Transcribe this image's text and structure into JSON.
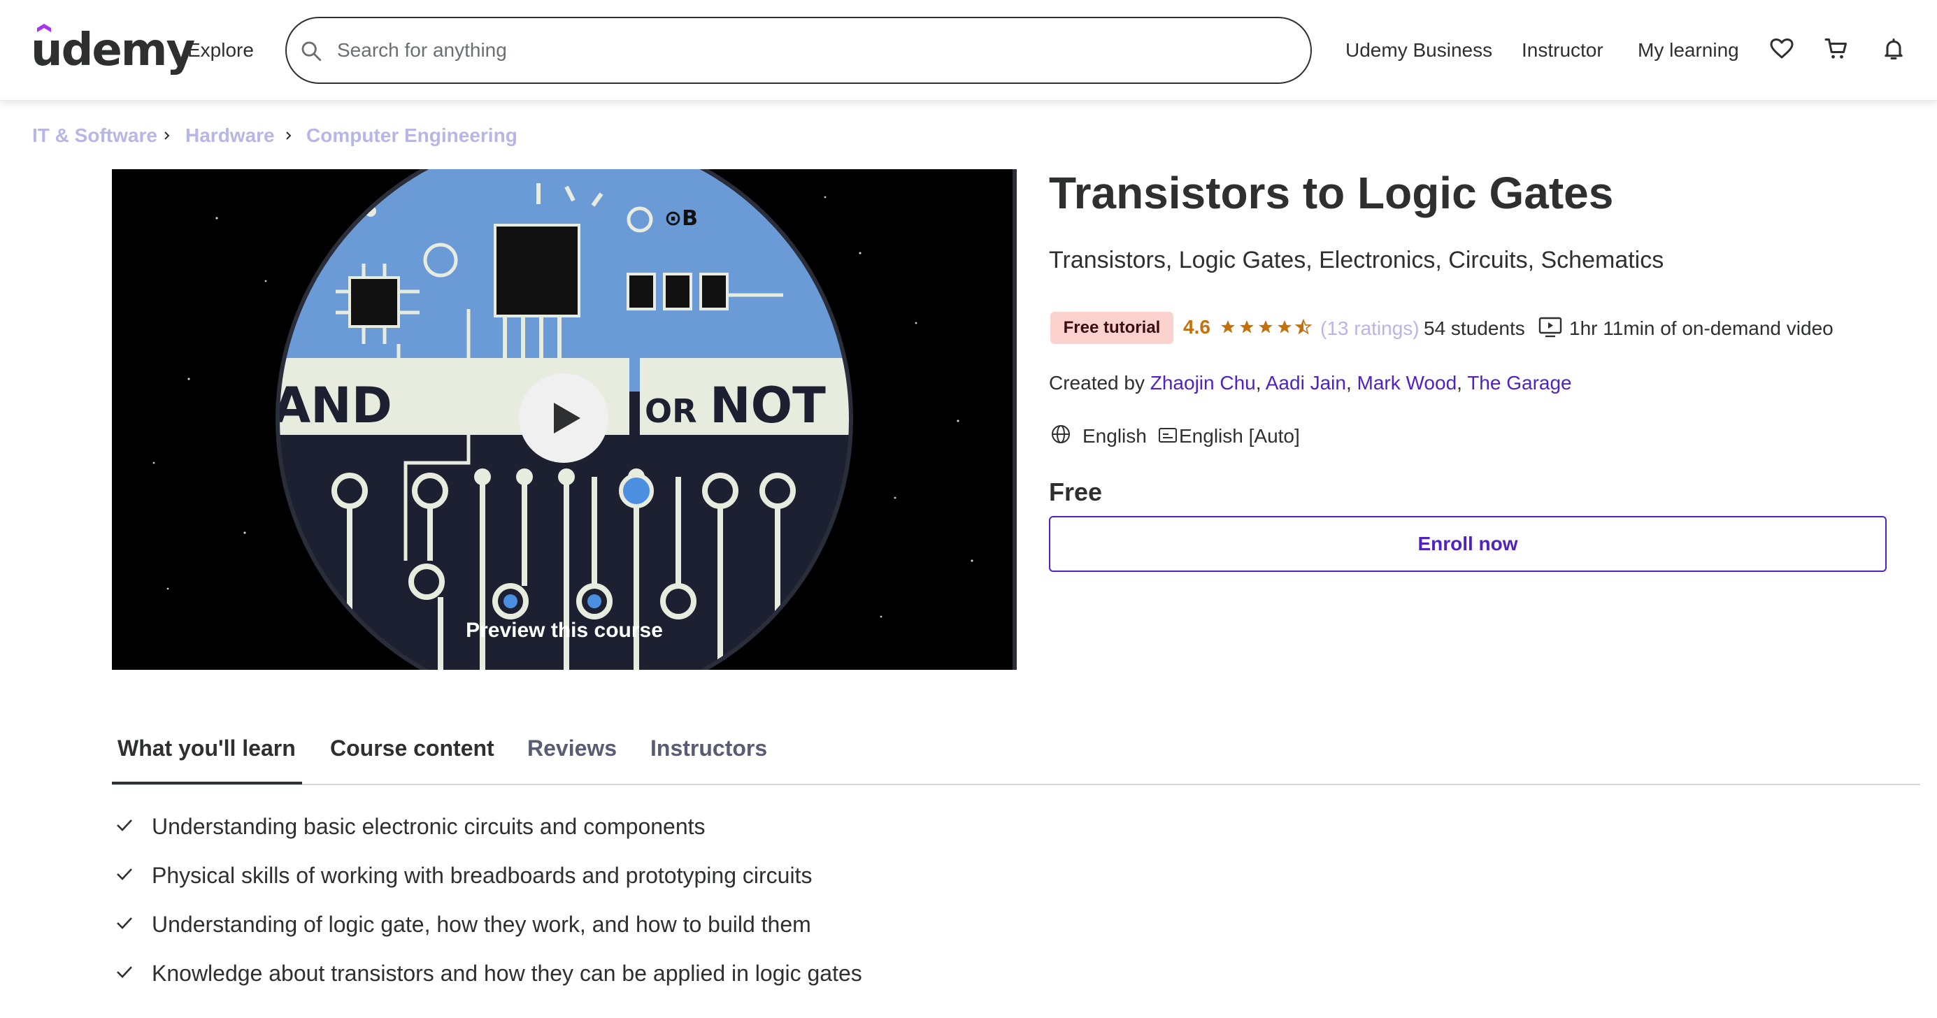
{
  "header": {
    "logo_text": "udemy",
    "explore_label": "Explore",
    "search_placeholder": "Search for anything",
    "nav": {
      "business": "Udemy Business",
      "instructor": "Instructor",
      "my_learning": "My learning"
    },
    "icons": [
      "heart-icon",
      "cart-icon",
      "bell-icon"
    ]
  },
  "breadcrumb": [
    "IT & Software",
    "Hardware",
    "Computer Engineering"
  ],
  "preview": {
    "label": "Preview this course",
    "image_text": {
      "and": "AND",
      "or": "OR",
      "not": "NOT",
      "corner": "⊙B"
    }
  },
  "course": {
    "title": "Transistors to Logic Gates",
    "subtitle": "Transistors, Logic Gates, Electronics, Circuits, Schematics",
    "badge": "Free tutorial",
    "rating": "4.6",
    "rating_value": 4.6,
    "rating_count": "(13 ratings)",
    "students": "54 students",
    "video_length": "1hr 11min of on-demand video",
    "created_by_label": "Created by",
    "authors": [
      "Zhaojin Chu",
      "Aadi Jain",
      "Mark Wood",
      "The Garage"
    ],
    "language": "English",
    "captions": "English [Auto]",
    "price": "Free",
    "enroll_label": "Enroll now"
  },
  "tabs": [
    {
      "label": "What you'll learn",
      "active": true
    },
    {
      "label": "Course content",
      "active": false
    },
    {
      "label": "Reviews",
      "active": false
    },
    {
      "label": "Instructors",
      "active": false
    }
  ],
  "learn_items": [
    "Understanding basic electronic circuits and components",
    "Physical skills of working with breadboards and prototyping circuits",
    "Understanding of logic gate, how they work, and how to build them",
    "Knowledge about transistors and how they can be applied in logic gates"
  ],
  "colors": {
    "brand": "#a435f0",
    "link": "#5022c3",
    "rating": "#c4710d",
    "badge_bg": "#fbd2ce"
  }
}
